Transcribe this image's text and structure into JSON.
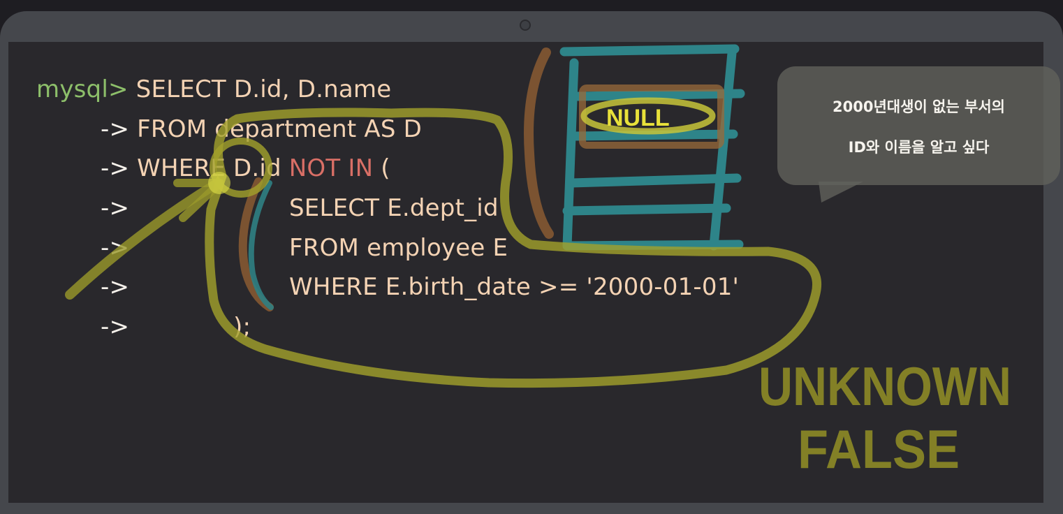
{
  "sql": {
    "prompt": "mysql>",
    "line1": " SELECT D.id, D.name",
    "continuation": "->",
    "line2": " FROM department AS D",
    "line3_a": " WHERE D.id ",
    "line3_kw": "NOT IN",
    "line3_b": " (",
    "line4": "SELECT E.dept_id",
    "line5": "FROM employee E",
    "line6": "WHERE E.birth_date >= '2000-01-01'",
    "line7": ");"
  },
  "bubble": {
    "line1": "2000년대생이 없는 부서의",
    "line2": "ID와 이름을 알고 싶다"
  },
  "annotations": {
    "null_label": "NULL",
    "unknown_label": "UNKNOWN",
    "false_label": "FALSE"
  }
}
